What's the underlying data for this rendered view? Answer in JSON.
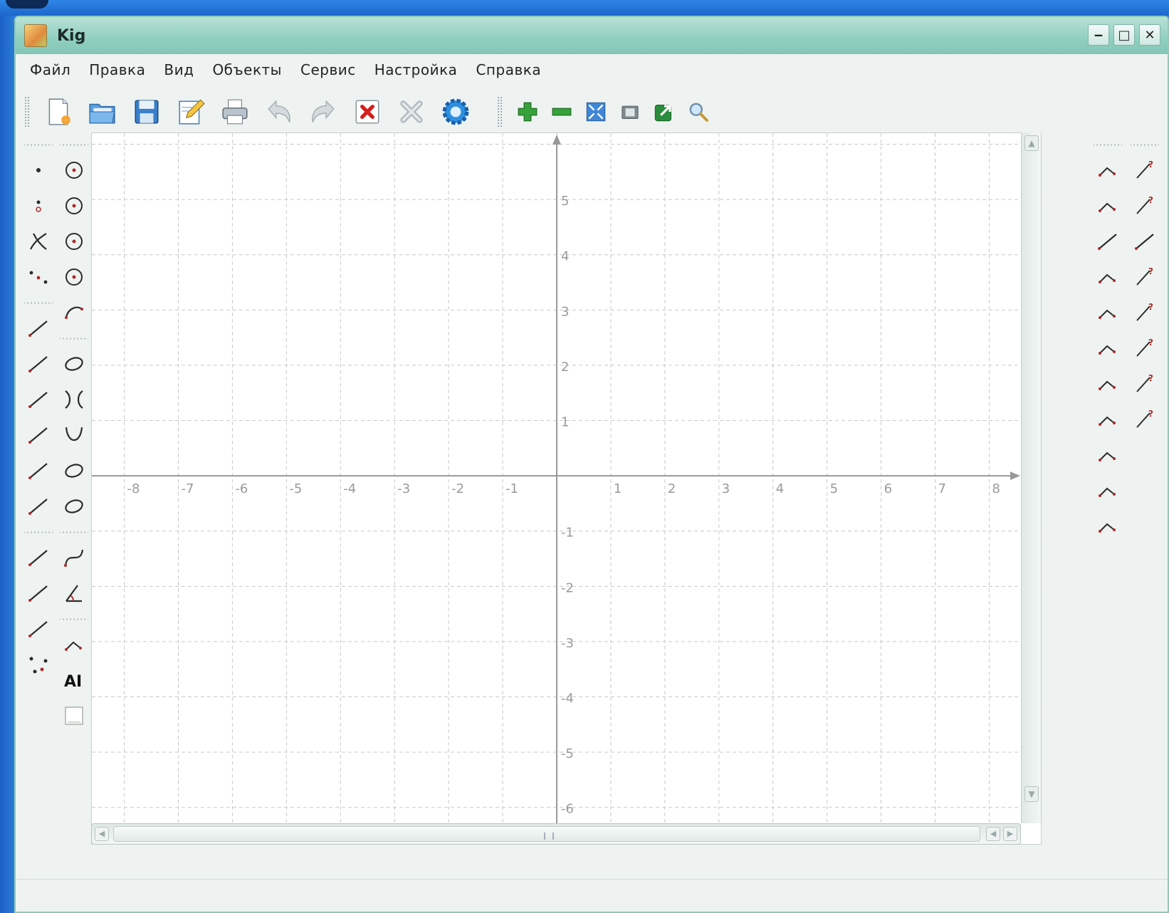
{
  "window": {
    "title": "Kig",
    "buttons": {
      "minimize": "‒",
      "maximize": "□",
      "close": "✕"
    }
  },
  "menu": {
    "items": [
      "Файл",
      "Правка",
      "Вид",
      "Объекты",
      "Сервис",
      "Настройка",
      "Справка"
    ]
  },
  "toolbar": {
    "main": [
      "new-document-icon",
      "open-folder-icon",
      "save-icon",
      "edit-document-icon",
      "print-icon",
      "undo-icon",
      "redo-icon",
      "delete-icon",
      "cancel-construction-icon",
      "settings-gear-icon"
    ],
    "view": [
      "zoom-in-icon",
      "zoom-out-icon",
      "fit-to-screen-icon",
      "screenshot-icon",
      "export-icon",
      "zoom-magnifier-icon"
    ]
  },
  "left_tools": {
    "column1": [
      "point-icon",
      "constrained-point-icon",
      "intersection-point-icon",
      "midpoint-icon",
      "sep",
      "line-icon",
      "segment-icon",
      "ray-icon",
      "parallel-line-icon",
      "perpendicular-line-icon",
      "bisector-line-icon",
      "sep",
      "vector-icon",
      "vector-sum-icon",
      "segment-sum-icon",
      "polygon-vertices-icon"
    ],
    "column2": [
      "circle-center-point-icon",
      "circle-three-points-icon",
      "circle-center-radius-icon",
      "circle-concentric-icon",
      "arc-icon",
      "sep",
      "conic-five-points-icon",
      "hyperbola-icon",
      "parabola-icon",
      "conic-general-icon",
      "conic-degenerate-icon",
      "sep",
      "bezier-curve-icon",
      "angle-icon",
      "sep",
      "locus-icon",
      "text-label-icon",
      "image-icon"
    ]
  },
  "left_text_tool": "AI",
  "right_tools": {
    "column1": [
      "translation-icon",
      "point-reflection-icon",
      "line-reflection-icon",
      "rotation-icon",
      "scaling-icon",
      "similitude-icon",
      "harmonic-homology-icon",
      "inversion-icon",
      "projective-icon",
      "affinity-icon",
      "affinity-triangle-icon"
    ],
    "column2": [
      "test-parallel-icon",
      "test-orthogonal-icon",
      "test-collinear-icon",
      "test-on-curve-icon",
      "test-convex-icon",
      "test-square-icon",
      "test-existence-icon",
      "test-in-polygon-icon"
    ]
  },
  "chart_data": {
    "type": "line",
    "x_ticks": [
      "-8",
      "-7",
      "-6",
      "-5",
      "-4",
      "-3",
      "-2",
      "-1",
      "1",
      "2",
      "3",
      "4",
      "5",
      "6",
      "7",
      "8"
    ],
    "y_ticks": [
      "5",
      "4",
      "3",
      "2",
      "1",
      "-1",
      "-2",
      "-3",
      "-4",
      "-5",
      "-6"
    ],
    "xlim": [
      -8.6,
      8.6
    ],
    "ylim": [
      -6.3,
      6.2
    ],
    "grid": true
  }
}
